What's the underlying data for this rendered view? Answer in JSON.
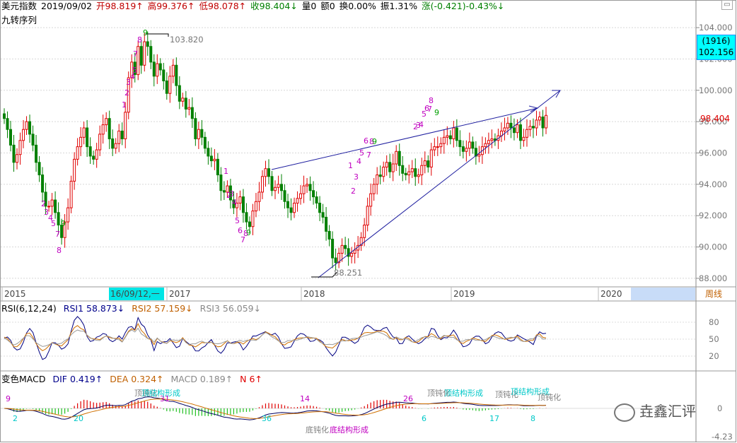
{
  "header": {
    "name": "美元指数",
    "date": "2019/09/02",
    "open": "开98.819↑",
    "high": "高99.376↑",
    "low": "低98.078↑",
    "close": "收98.404↓",
    "volume": "量0",
    "amount": "额0",
    "turnover": "换0.00%",
    "amplitude": "振1.31%",
    "change": "涨(-0.421)-0.43%↓"
  },
  "indicator_name": "九转序列",
  "right_panel": {
    "count": "(1916)",
    "price_box": "102.156",
    "last_price": "98.404",
    "period": "周线",
    "minimize_icon": "minimize-icon"
  },
  "rsi": {
    "title": "RSI(6,12,24)",
    "rsi1": "RSI1 58.873↓",
    "rsi2": "RSI2 57.159↓",
    "rsi3": "RSI3 56.059↓"
  },
  "macd": {
    "title": "变色MACD",
    "dif": "DIF 0.419↑",
    "dea": "DEA 0.324↑",
    "macd": "MACD 0.189↑",
    "n": "N 6↑"
  },
  "watermark": "垚鑫汇评",
  "colors": {
    "up": "#e00000",
    "down": "#008000",
    "blue": "#0000a0",
    "purple": "#c000c0",
    "cyan": "#00c8c8"
  },
  "chart_data": {
    "type": "candlestick",
    "ylim": [
      87.5,
      104.5
    ],
    "yticks": [
      "104.000",
      "102.000",
      "100.000",
      "98.000",
      "96.000",
      "94.000",
      "92.000",
      "90.000",
      "88.000"
    ],
    "x_years": [
      "2015",
      "2017",
      "2018",
      "2019",
      "2020"
    ],
    "cursor_date": "16/09/12,一",
    "annotations": [
      "103.820",
      "88.251"
    ],
    "series": [
      {
        "name": "close",
        "values": [
          98.2,
          97.5,
          96.5,
          95.4,
          95.9,
          96.8,
          97.5,
          98.0,
          97.2,
          96.5,
          95.4,
          94.6,
          93.5,
          92.6,
          92.6,
          93.0,
          92.2,
          91.4,
          90.6,
          91.6,
          92.5,
          94.2,
          95.6,
          96.4,
          97.0,
          97.6,
          96.4,
          95.8,
          95.6,
          96.2,
          97.2,
          97.8,
          98.2,
          96.9,
          96.3,
          96.6,
          97.4,
          96.9,
          98.6,
          100.8,
          101.8,
          101.0,
          102.8,
          101.6,
          103.1,
          102.8,
          101.8,
          100.9,
          101.7,
          101.3,
          100.6,
          99.8,
          100.9,
          101.6,
          100.3,
          99.3,
          99.5,
          98.8,
          98.9,
          98.2,
          96.9,
          97.5,
          97.0,
          96.3,
          95.8,
          95.5,
          95.6,
          94.6,
          93.6,
          93.5,
          93.9,
          93.0,
          92.5,
          92.8,
          93.2,
          92.2,
          91.6,
          91.3,
          92.3,
          92.9,
          93.5,
          94.5,
          95.0,
          94.5,
          93.6,
          93.8,
          94.0,
          93.6,
          92.9,
          92.5,
          92.2,
          92.8,
          93.1,
          93.4,
          93.9,
          94.0,
          93.6,
          93.2,
          92.8,
          92.2,
          91.9,
          91.0,
          90.5,
          89.3,
          89.0,
          89.6,
          90.1,
          89.9,
          89.4,
          89.6,
          89.8,
          90.1,
          90.6,
          91.4,
          92.6,
          93.4,
          94.0,
          94.6,
          94.5,
          95.1,
          95.4,
          94.8,
          95.3,
          96.1,
          95.2,
          94.7,
          94.6,
          94.8,
          95.0,
          94.5,
          94.6,
          95.2,
          95.5,
          95.1,
          96.2,
          96.4,
          96.4,
          96.6,
          97.0,
          97.1,
          96.9,
          97.6,
          96.8,
          96.4,
          96.1,
          96.3,
          96.7,
          96.3,
          95.8,
          95.9,
          96.4,
          96.6,
          96.8,
          96.9,
          96.8,
          97.1,
          97.4,
          97.6,
          97.9,
          97.6,
          97.3,
          97.8,
          96.8,
          97.0,
          97.5,
          97.7,
          97.6,
          98.1,
          98.3,
          97.6,
          98.4
        ]
      },
      {
        "name": "RSI1",
        "values": [
          58.873
        ]
      },
      {
        "name": "RSI2",
        "values": [
          57.159
        ]
      },
      {
        "name": "RSI3",
        "values": [
          56.059
        ]
      },
      {
        "name": "DIF",
        "values": [
          0.419
        ]
      },
      {
        "name": "DEA",
        "values": [
          0.324
        ]
      }
    ],
    "rsi_yticks": [
      "80",
      "50",
      "20"
    ],
    "macd_yticks": [
      "0",
      "-4.23"
    ],
    "td_labels": [
      [
        "2",
        "3",
        "4",
        "5",
        "7",
        "8",
        "9"
      ],
      [
        "1",
        "2",
        "3",
        "4",
        "5",
        "7",
        "8",
        "9"
      ],
      [
        "1",
        "2",
        "3",
        "4",
        "5",
        "6",
        "7",
        "8",
        "9"
      ],
      [
        "1",
        "2",
        "3",
        "4",
        "5",
        "6",
        "7",
        "8",
        "9"
      ],
      [
        "2",
        "3",
        "4",
        "5",
        "6",
        "7",
        "8",
        "9"
      ]
    ],
    "macd_labels": {
      "counts": [
        "9",
        "2",
        "20",
        "31",
        "36",
        "14",
        "26",
        "6",
        "17",
        "8"
      ],
      "signals": [
        "顶钝化",
        "顶结构形成",
        "底钝化",
        "底结构形成",
        "顶钝化",
        "顶结构形成",
        "顶钝化",
        "顶结构形成",
        "顶钝化"
      ]
    }
  }
}
